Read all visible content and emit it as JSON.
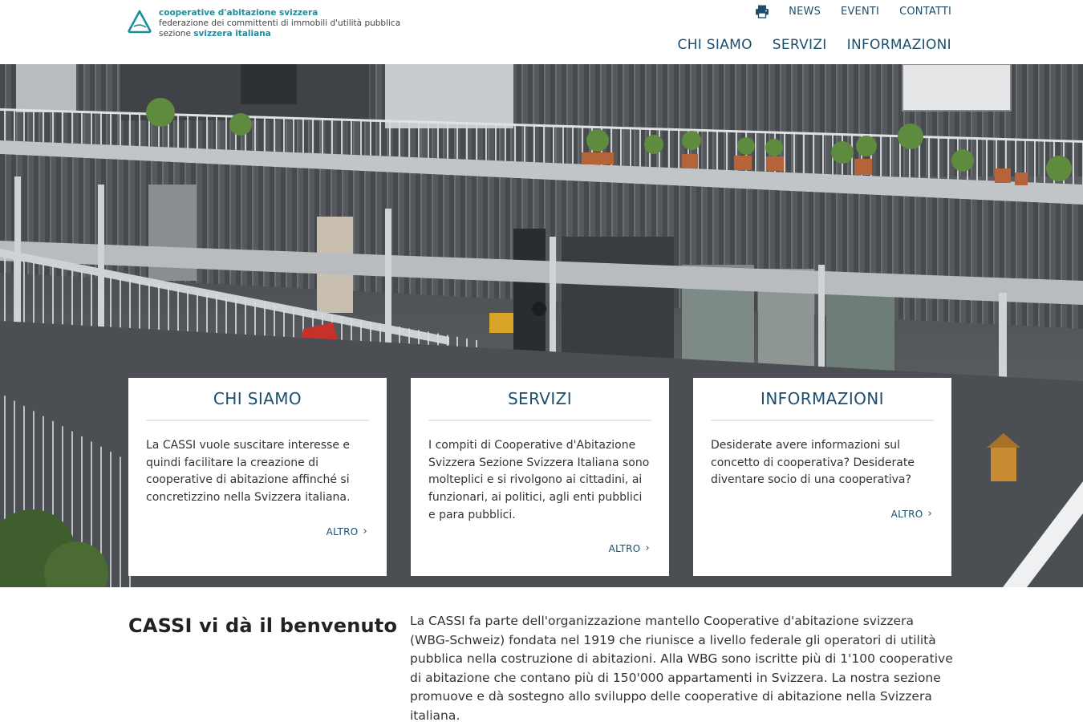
{
  "header": {
    "logo": {
      "line1": "cooperative d'abitazione svizzera",
      "line2": "federazione dei committenti di immobili d'utilità pubblica",
      "line3_prefix": "sezione ",
      "line3_emph": "svizzera italiana"
    },
    "top_nav": [
      "NEWS",
      "EVENTI",
      "CONTATTI"
    ],
    "main_nav": [
      "CHI SIAMO",
      "SERVIZI",
      "INFORMAZIONI"
    ],
    "print_icon": "printer-icon"
  },
  "cards": [
    {
      "title": "CHI SIAMO",
      "text": "La CASSI vuole suscitare interesse e quindi facilitare la creazione di cooperative di abitazione affinché si concretizzino nella Svizzera italiana.",
      "more": "ALTRO"
    },
    {
      "title": "SERVIZI",
      "text": "I compiti di Cooperative d'Abitazione Svizzera Sezione Svizzera Italiana sono molteplici e si rivolgono ai cittadini, ai funzionari, ai politici, agli enti pubblici e para pubblici.",
      "more": "ALTRO"
    },
    {
      "title": "INFORMAZIONI",
      "text": "Desiderate avere informazioni sul concetto di cooperativa? Desiderate diventare socio di una cooperativa?",
      "more": "ALTRO"
    }
  ],
  "welcome": {
    "title": "CASSI vi dà il benvenuto",
    "text": "La CASSI fa parte dell'organizzazione mantello Cooperative d'abitazione svizzera (WBG-Schweiz) fondata nel 1919 che riunisce a livello federale gli operatori di utilità pubblica nella costruzione di abitazioni. Alla WBG sono iscritte più di 1'100 cooperative di abitazione che contano più di 150'000 appartamenti in Svizzera. La nostra sezione promuove e dà sostegno allo sviluppo delle cooperative di abitazione nella Svizzera italiana."
  },
  "colors": {
    "brand_teal": "#1a8e9c",
    "nav_blue": "#1c4f6e"
  }
}
